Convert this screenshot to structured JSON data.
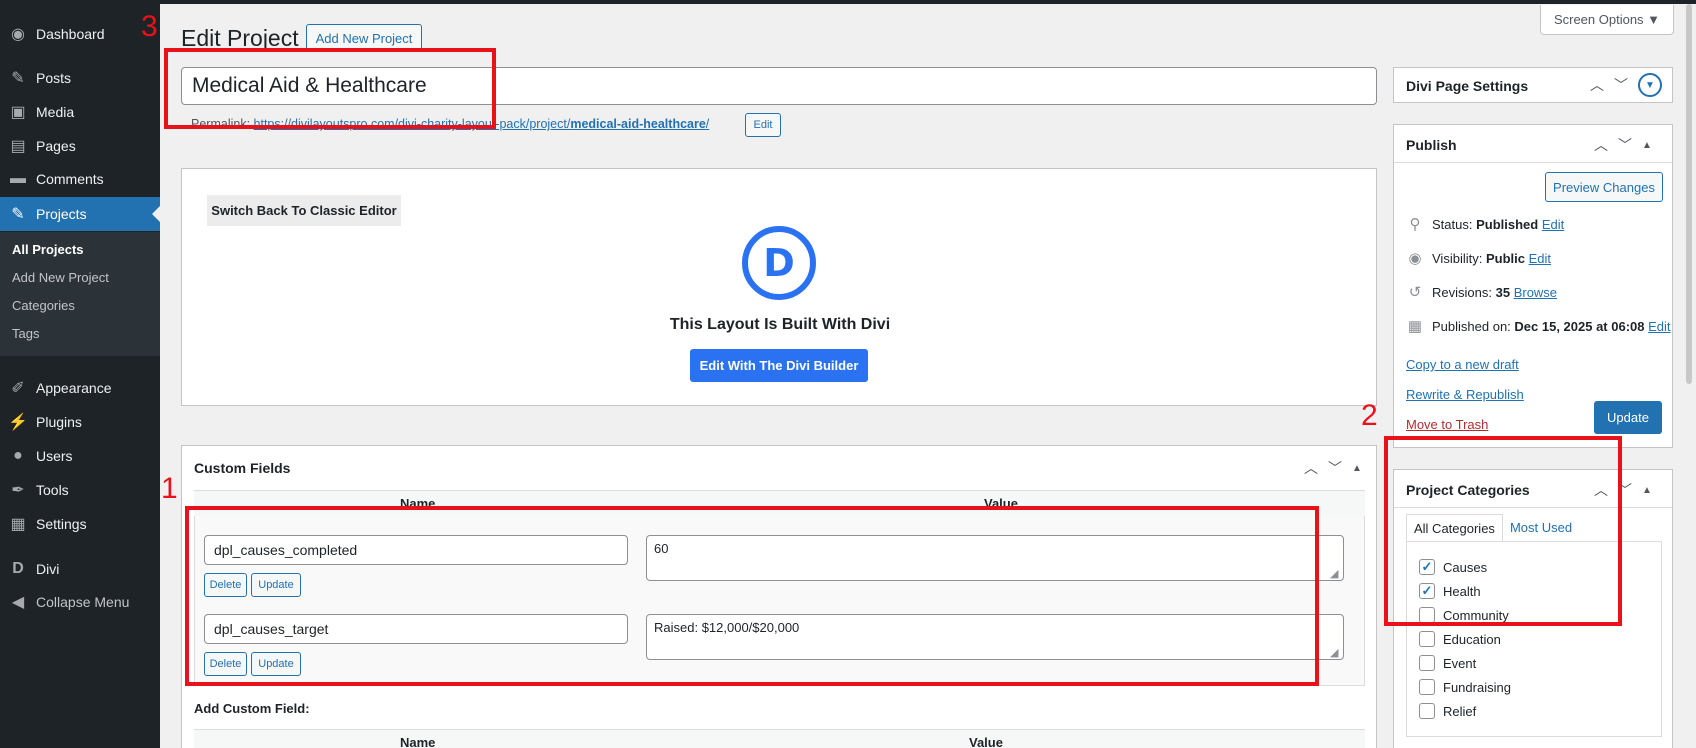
{
  "sidebar": {
    "items": [
      {
        "label": "Dashboard",
        "icon": "dashboard-icon",
        "glyph": "◉"
      },
      {
        "label": "Posts",
        "icon": "pin-icon",
        "glyph": "✎"
      },
      {
        "label": "Media",
        "icon": "media-icon",
        "glyph": "▣"
      },
      {
        "label": "Pages",
        "icon": "pages-icon",
        "glyph": "▤"
      },
      {
        "label": "Comments",
        "icon": "comments-icon",
        "glyph": "▬"
      },
      {
        "label": "Projects",
        "icon": "pin-icon",
        "glyph": "✎"
      },
      {
        "label": "Appearance",
        "icon": "brush-icon",
        "glyph": "✐"
      },
      {
        "label": "Plugins",
        "icon": "plugin-icon",
        "glyph": "⚡"
      },
      {
        "label": "Users",
        "icon": "user-icon",
        "glyph": "●"
      },
      {
        "label": "Tools",
        "icon": "wrench-icon",
        "glyph": "✒"
      },
      {
        "label": "Settings",
        "icon": "settings-icon",
        "glyph": "▦"
      },
      {
        "label": "Divi",
        "icon": "divi-icon",
        "glyph": "D"
      },
      {
        "label": "Collapse Menu",
        "icon": "collapse-icon",
        "glyph": "◀"
      }
    ],
    "submenu": [
      "All Projects",
      "Add New Project",
      "Categories",
      "Tags"
    ]
  },
  "header": {
    "title": "Edit Project",
    "add_new": "Add New Project",
    "screen_options": "Screen Options ▼"
  },
  "post": {
    "title_value": "Medical Aid & Healthcare",
    "permalink_label": "Permalink:",
    "permalink_base": "https://divilayoutspro.com/divi-charity-layout-pack/project/",
    "permalink_slug": "medical-aid-healthcare",
    "permalink_slash": "/",
    "edit_label": "Edit"
  },
  "divi": {
    "classic_btn": "Switch Back To Classic Editor",
    "logo_letter": "D",
    "built_text": "This Layout Is Built With Divi",
    "builder_btn": "Edit With The Divi Builder"
  },
  "custom_fields": {
    "title": "Custom Fields",
    "col_name": "Name",
    "col_value": "Value",
    "rows": [
      {
        "key": "dpl_causes_completed",
        "value": "60"
      },
      {
        "key": "dpl_causes_target",
        "value": "Raised: $12,000/$20,000"
      }
    ],
    "delete_label": "Delete",
    "update_label": "Update",
    "add_title": "Add Custom Field:"
  },
  "divi_settings": {
    "title": "Divi Page Settings"
  },
  "publish": {
    "title": "Publish",
    "preview": "Preview Changes",
    "status_label": "Status:",
    "status_value": "Published",
    "visibility_label": "Visibility:",
    "visibility_value": "Public",
    "revisions_label": "Revisions:",
    "revisions_value": "35",
    "browse": "Browse",
    "published_label": "Published on:",
    "published_value": "Dec 15, 2025 at 06:08",
    "edit": "Edit",
    "copy_draft": "Copy to a new draft",
    "rewrite": "Rewrite & Republish",
    "trash": "Move to Trash",
    "update": "Update"
  },
  "categories": {
    "title": "Project Categories",
    "tab_all": "All Categories",
    "tab_used": "Most Used",
    "items": [
      {
        "label": "Causes",
        "checked": true
      },
      {
        "label": "Health",
        "checked": true
      },
      {
        "label": "Community",
        "checked": false
      },
      {
        "label": "Education",
        "checked": false
      },
      {
        "label": "Event",
        "checked": false
      },
      {
        "label": "Fundraising",
        "checked": false
      },
      {
        "label": "Relief",
        "checked": false
      }
    ]
  },
  "annotations": {
    "n1": "1",
    "n2": "2",
    "n3": "3"
  },
  "colors": {
    "wp_blue": "#2271b1",
    "divi_blue": "#2b72f3",
    "annotation_red": "#e8131a",
    "sidebar_dark": "#1d2327"
  }
}
